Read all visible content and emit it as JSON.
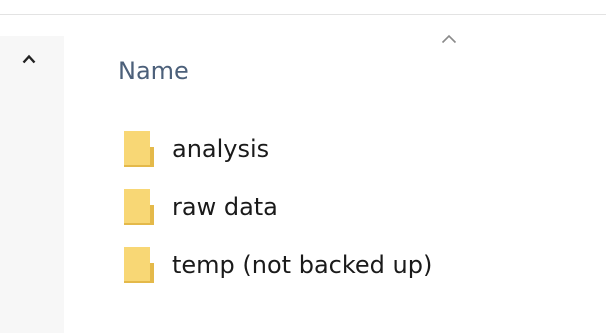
{
  "list": {
    "column_header": "Name",
    "items": [
      {
        "name": "analysis",
        "icon": "folder-icon"
      },
      {
        "name": "raw data",
        "icon": "folder-icon"
      },
      {
        "name": "temp (not backed up)",
        "icon": "folder-icon"
      }
    ]
  },
  "colors": {
    "folder": "#f8d775",
    "folder_shade": "#e4b94a",
    "header_text": "#4c607a"
  }
}
